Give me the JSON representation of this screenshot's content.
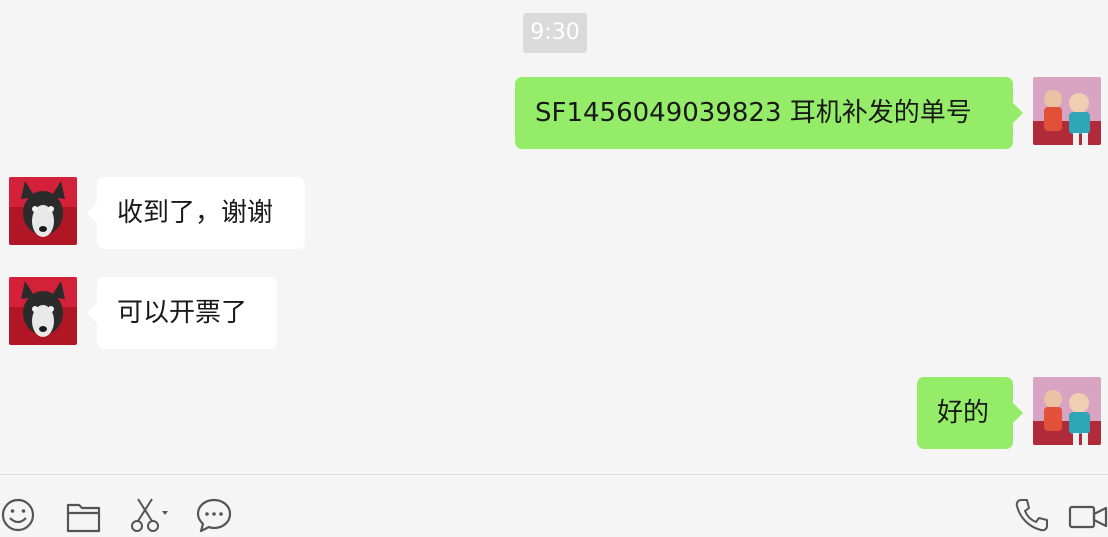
{
  "chat": {
    "timestamp": "9:30",
    "messages": [
      {
        "side": "right",
        "sender": "me",
        "text": "SF1456049039823  耳机补发的单号"
      },
      {
        "side": "left",
        "sender": "contact",
        "text": "收到了，谢谢"
      },
      {
        "side": "left",
        "sender": "contact",
        "text": "可以开票了"
      },
      {
        "side": "right",
        "sender": "me",
        "text": "好的"
      }
    ]
  },
  "toolbar": {
    "left_icons": [
      "emoji-icon",
      "folder-icon",
      "scissors-icon",
      "chat-bubble-icon"
    ],
    "right_icons": [
      "phone-icon",
      "video-icon"
    ]
  },
  "colors": {
    "background": "#f5f5f5",
    "outgoing_bubble": "#95ec69",
    "incoming_bubble": "#ffffff",
    "timestamp_bg": "#dadada",
    "icon_stroke": "#555555"
  }
}
